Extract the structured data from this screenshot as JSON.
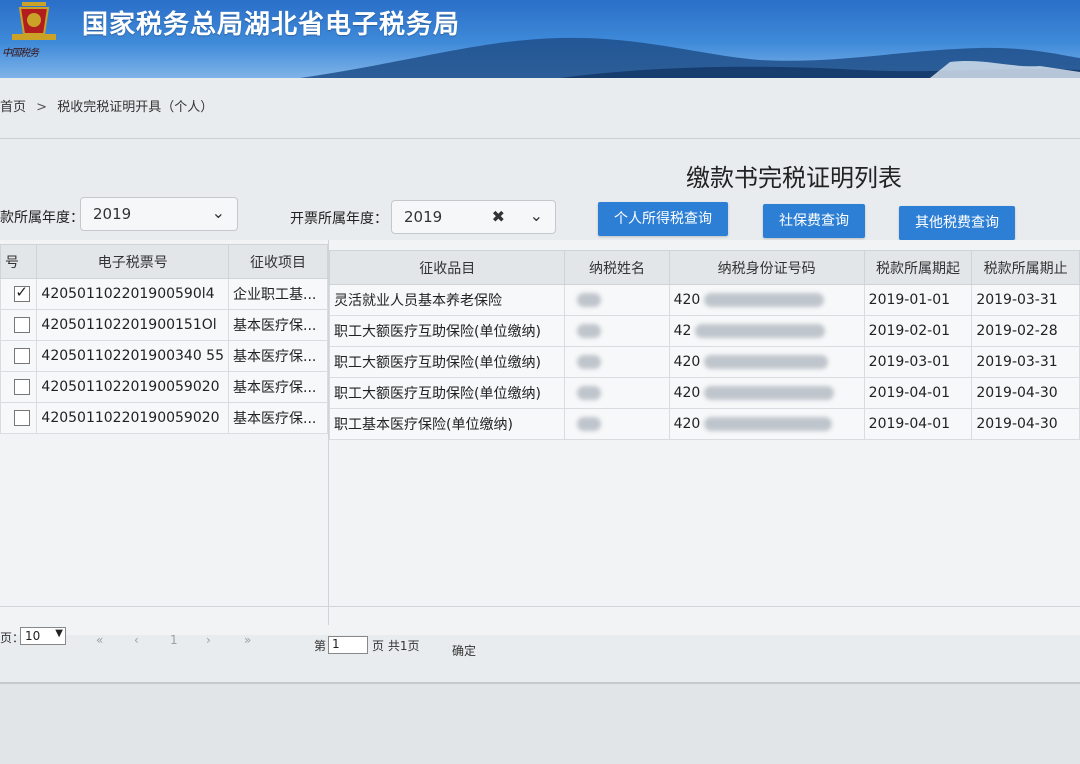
{
  "header": {
    "site_title": "国家税务总局湖北省电子税务局",
    "emblem_caption": "中国税务"
  },
  "breadcrumb": {
    "home": "首页",
    "separator": ">",
    "current": "税收完税证明开具（个人）"
  },
  "page_heading": "缴款书完税证明列表",
  "filters": {
    "payment_year_label": "款所属年度：",
    "payment_year_value": "2019",
    "invoice_year_label": "开票所属年度：",
    "invoice_year_value": "2019"
  },
  "buttons": {
    "personal_income_tax": "个人所得税查询",
    "social_security": "社保费查询",
    "other_taxes": "其他税费查询"
  },
  "left_table": {
    "columns": [
      "号",
      "电子税票号",
      "征收项目"
    ],
    "rows": [
      {
        "checked": true,
        "ticket_no": "420501102201900590l4",
        "item": "企业职工基..."
      },
      {
        "checked": false,
        "ticket_no": "420501102201900151Ol",
        "item": "基本医疗保..."
      },
      {
        "checked": false,
        "ticket_no": "420501102201900340 55",
        "item": "基本医疗保..."
      },
      {
        "checked": false,
        "ticket_no": "42050110220190059020",
        "item": "基本医疗保..."
      },
      {
        "checked": false,
        "ticket_no": "42050110220190059020",
        "item": "基本医疗保..."
      }
    ]
  },
  "right_table": {
    "columns": [
      "征收品目",
      "纳税姓名",
      "纳税身份证号码",
      "税款所属期起",
      "税款所属期止"
    ],
    "rows": [
      {
        "category": "灵活就业人员基本养老保险",
        "name": "",
        "id_prefix": "420",
        "start": "2019-01-01",
        "end": "2019-03-31"
      },
      {
        "category": "职工大额医疗互助保险(单位缴纳)",
        "name": "",
        "id_prefix": "42",
        "start": "2019-02-01",
        "end": "2019-02-28"
      },
      {
        "category": "职工大额医疗互助保险(单位缴纳)",
        "name": "",
        "id_prefix": "420",
        "start": "2019-03-01",
        "end": "2019-03-31"
      },
      {
        "category": "职工大额医疗互助保险(单位缴纳)",
        "name": "",
        "id_prefix": "420",
        "start": "2019-04-01",
        "end": "2019-04-30"
      },
      {
        "category": "职工基本医疗保险(单位缴纳)",
        "name": "",
        "id_prefix": "420",
        "start": "2019-04-01",
        "end": "2019-04-30"
      }
    ]
  },
  "pager": {
    "per_page_label": "页：",
    "per_page_value": "10",
    "first": "«",
    "prev": "‹",
    "current_page": "1",
    "next": "›",
    "last": "»",
    "goto_prefix": "第",
    "goto_value": "1",
    "goto_suffix": "页 共1页",
    "confirm": "确定"
  }
}
